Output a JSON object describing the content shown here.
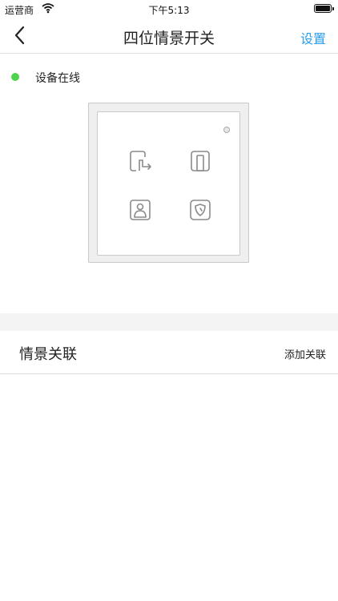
{
  "status_bar": {
    "carrier": "运营商",
    "time": "下午5:13"
  },
  "nav": {
    "title": "四位情景开关",
    "settings_label": "设置"
  },
  "device": {
    "status_text": "设备在线",
    "status_color": "#4cd24c"
  },
  "switch_keys": [
    {
      "icon": "leave-home-icon"
    },
    {
      "icon": "door-icon"
    },
    {
      "icon": "person-icon"
    },
    {
      "icon": "shield-icon"
    }
  ],
  "scene_association": {
    "title": "情景关联",
    "add_label": "添加关联"
  },
  "colors": {
    "accent": "#2b9ee8",
    "online": "#4cd24c",
    "icon_stroke": "#8a8a8a"
  }
}
